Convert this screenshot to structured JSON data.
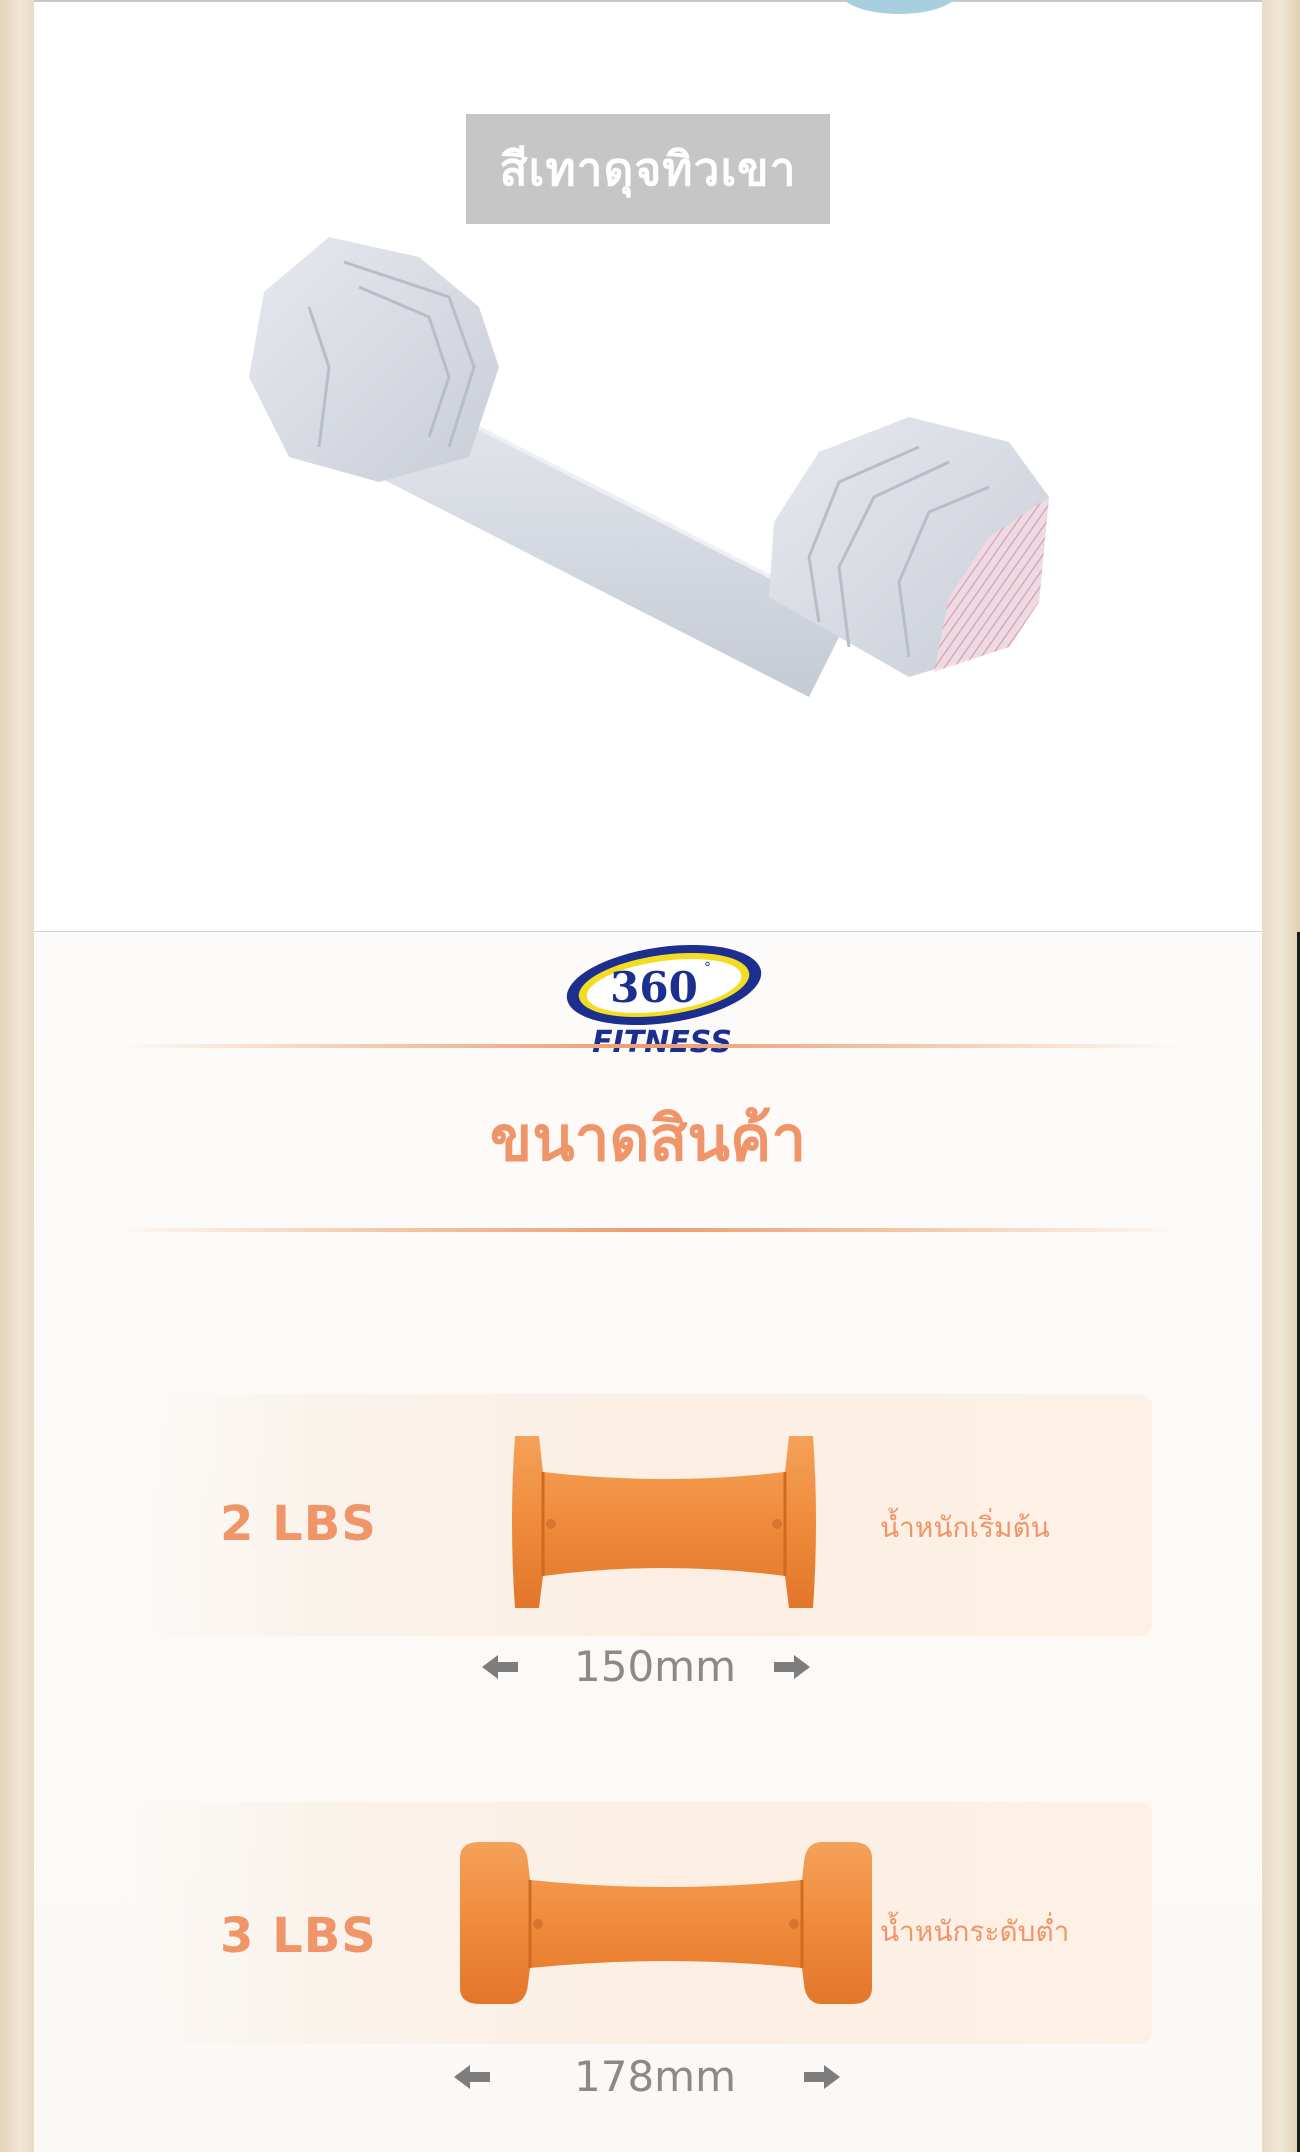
{
  "top_panel": {
    "color_badge": "สีเทาดุจทิวเขา"
  },
  "logo": {
    "number": "360",
    "degree": "°",
    "brand": "FITNESS"
  },
  "section": {
    "title": "ขนาดสินค้า"
  },
  "sizes": [
    {
      "weight": "2 LBS",
      "level": "น้ำหนักเริ่มต้น",
      "length": "150mm"
    },
    {
      "weight": "3 LBS",
      "level": "น้ำหนักระดับต่ำ",
      "length": "178mm"
    }
  ],
  "colors": {
    "accent_orange": "#f0956a",
    "dumbbell_orange": "#f28a3c",
    "dumbbell_gray": "#d7dbe3",
    "badge_gray": "#c6c6c6",
    "logo_blue": "#1c2f8f",
    "logo_yellow": "#f4dd21"
  }
}
